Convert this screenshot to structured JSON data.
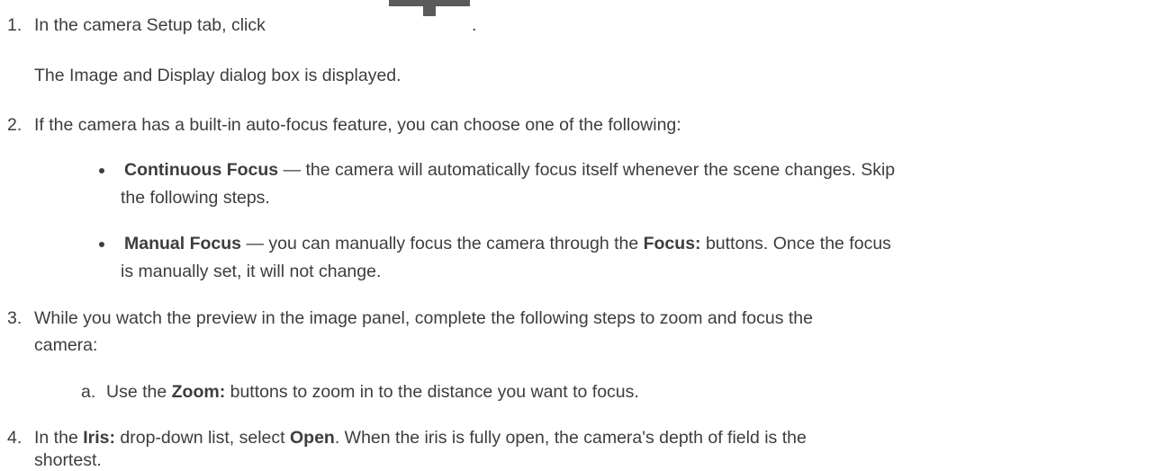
{
  "steps": [
    {
      "number": "1.",
      "text_before_icon": "In the camera Setup tab, click",
      "icon": "image-display-icon",
      "text_after_icon": ".",
      "note": "The Image and Display dialog box is displayed."
    },
    {
      "number": "2.",
      "text": "If the camera has a built-in auto-focus feature, you can choose one of the following:",
      "options": [
        {
          "bold": "Continuous Focus",
          "line1": " — the camera will automatically focus itself whenever the scene changes. Skip",
          "line2": "the following steps."
        },
        {
          "bold": "Manual Focus",
          "line1_a": " — you can manually focus the camera through the ",
          "line1_bold": "Focus:",
          "line1_b": " buttons. Once the focus",
          "line2": "is manually set, it will not change."
        }
      ]
    },
    {
      "number": "3.",
      "line1": "While you watch the preview in the image panel, complete the following steps to zoom and focus the",
      "line2": "camera:",
      "substeps": [
        {
          "letter": "a.",
          "text_a": "Use the ",
          "bold": "Zoom:",
          "text_b": " buttons to zoom in to the distance you want to focus."
        }
      ]
    },
    {
      "number": "4.",
      "text_a": "In the ",
      "bold1": "Iris:",
      "text_b": " drop-down list, select ",
      "bold2": "Open",
      "text_c": ". When the iris is fully open, the camera's depth of field is the",
      "line2": "shortest."
    }
  ]
}
